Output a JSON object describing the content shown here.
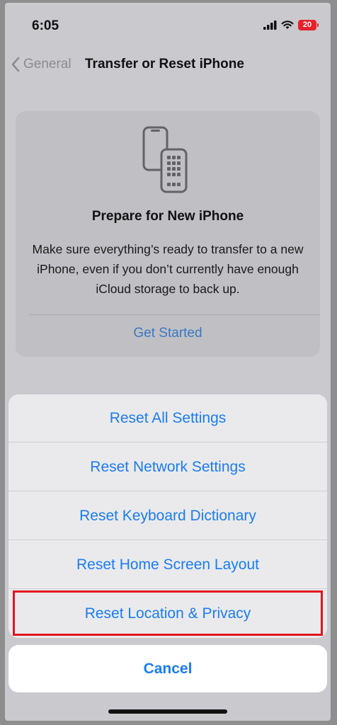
{
  "status_bar": {
    "time": "6:05",
    "battery_level": "20",
    "icons": [
      "cellular-signal-icon",
      "wifi-icon",
      "battery-icon"
    ]
  },
  "nav": {
    "back_label": "General",
    "title": "Transfer or Reset iPhone"
  },
  "prepare_card": {
    "icon": "phones-transfer-icon",
    "title": "Prepare for New iPhone",
    "description": "Make sure everything’s ready to transfer to a new iPhone, even if you don’t currently have enough iCloud storage to back up.",
    "action_label": "Get Started"
  },
  "action_sheet": {
    "options": [
      {
        "label": "Reset All Settings"
      },
      {
        "label": "Reset Network Settings"
      },
      {
        "label": "Reset Keyboard Dictionary"
      },
      {
        "label": "Reset Home Screen Layout"
      },
      {
        "label": "Reset Location & Privacy"
      }
    ],
    "cancel_label": "Cancel",
    "highlighted_option": "Reset Location & Privacy"
  },
  "colors": {
    "accent": "#1b7cf0",
    "highlight": "#e0151f",
    "battery_low": "#e8202a"
  }
}
